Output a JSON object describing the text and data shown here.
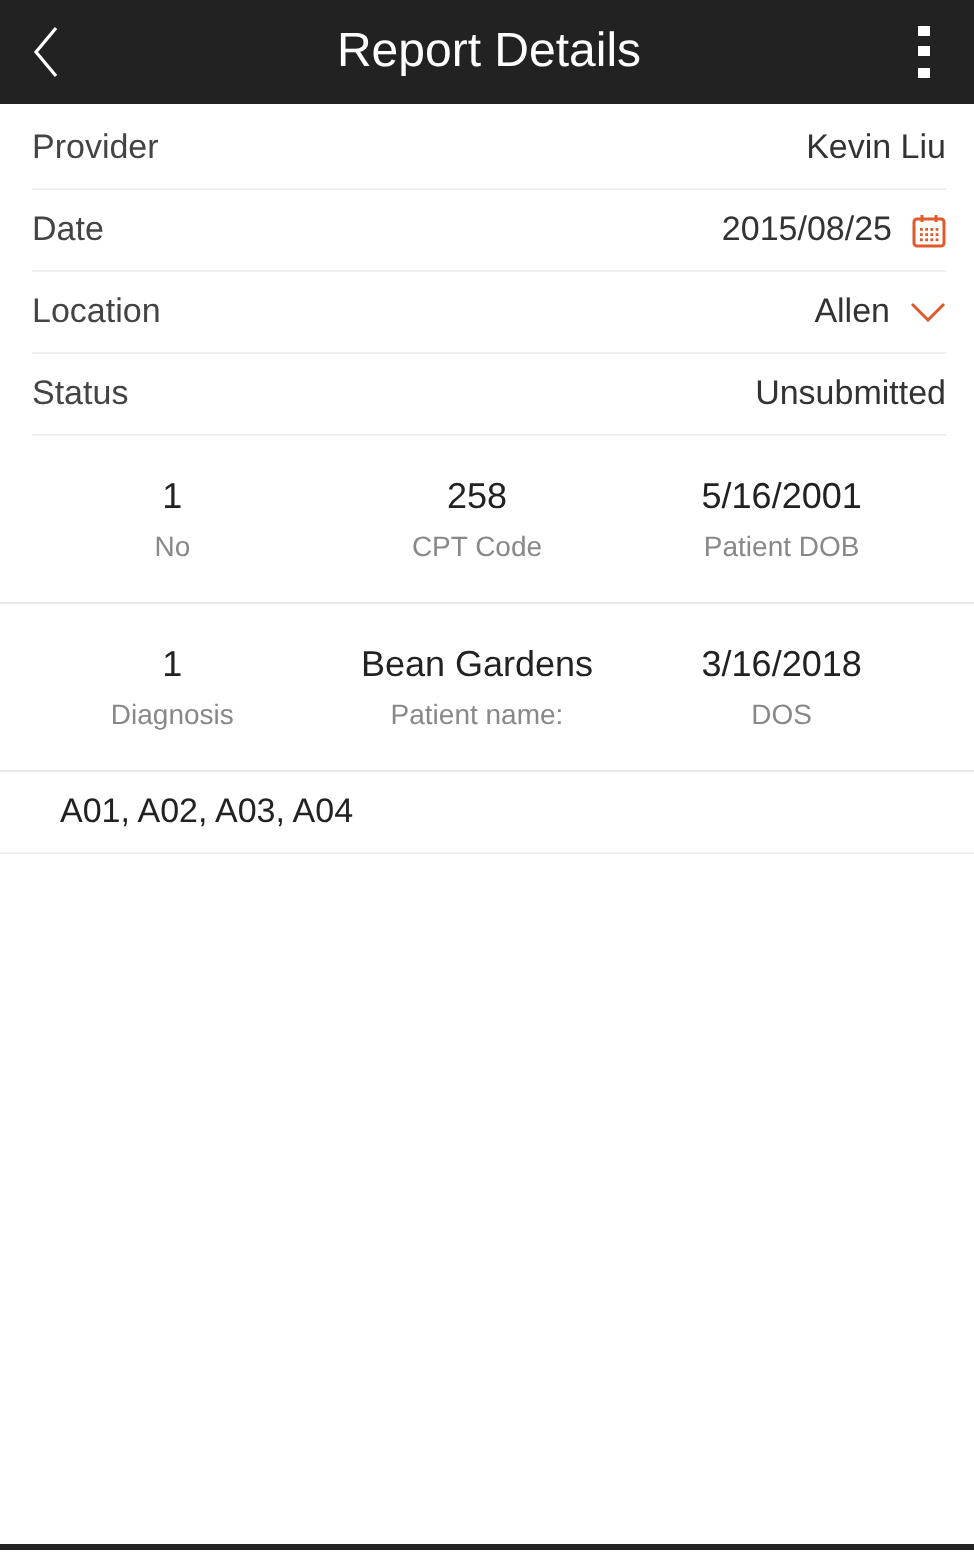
{
  "header": {
    "title": "Report Details"
  },
  "fields": [
    {
      "label": "Provider",
      "value": "Kevin Liu",
      "kind": "text"
    },
    {
      "label": "Date",
      "value": "2015/08/25",
      "kind": "date"
    },
    {
      "label": "Location",
      "value": "Allen",
      "kind": "select"
    },
    {
      "label": "Status",
      "value": "Unsubmitted",
      "kind": "text"
    }
  ],
  "detail_rows": [
    [
      {
        "value": "1",
        "label": "No"
      },
      {
        "value": "258",
        "label": "CPT Code"
      },
      {
        "value": "5/16/2001",
        "label": "Patient DOB"
      }
    ],
    [
      {
        "value": "1",
        "label": "Diagnosis"
      },
      {
        "value": "Bean Gardens",
        "label": "Patient name:"
      },
      {
        "value": "3/16/2018",
        "label": "DOS"
      }
    ]
  ],
  "diagnosis_codes": "A01, A02, A03, A04"
}
